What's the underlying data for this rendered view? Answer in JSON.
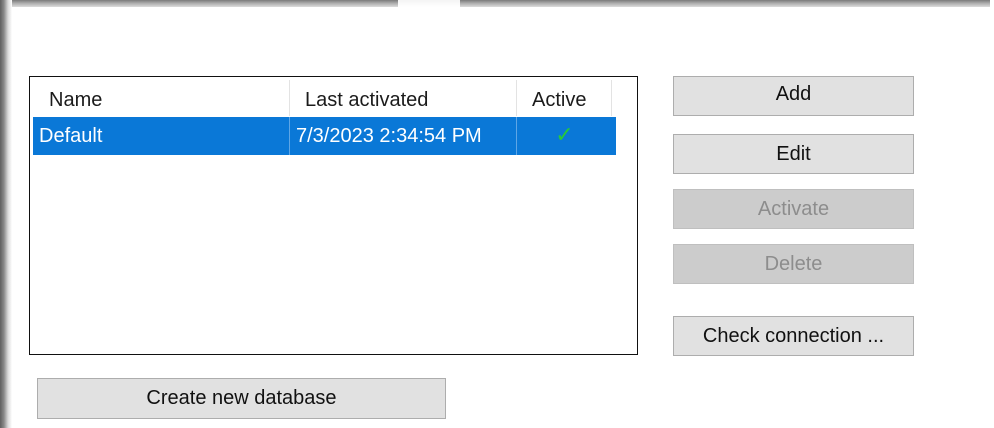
{
  "list": {
    "columns": {
      "name": "Name",
      "last_activated": "Last activated",
      "active": "Active"
    },
    "rows": [
      {
        "name": "Default",
        "last_activated": "7/3/2023 2:34:54 PM",
        "active_icon": "checkmark-icon",
        "active_glyph": "✓"
      }
    ],
    "selection_color": "#0a78d7"
  },
  "buttons": {
    "add": "Add",
    "edit": "Edit",
    "activate": "Activate",
    "delete": "Delete",
    "check_connection": "Check connection ...",
    "create_new_database": "Create new database"
  },
  "colors": {
    "check": "#27c93a",
    "button_face": "#e1e1e1",
    "disabled_button_face": "#cccccc"
  }
}
